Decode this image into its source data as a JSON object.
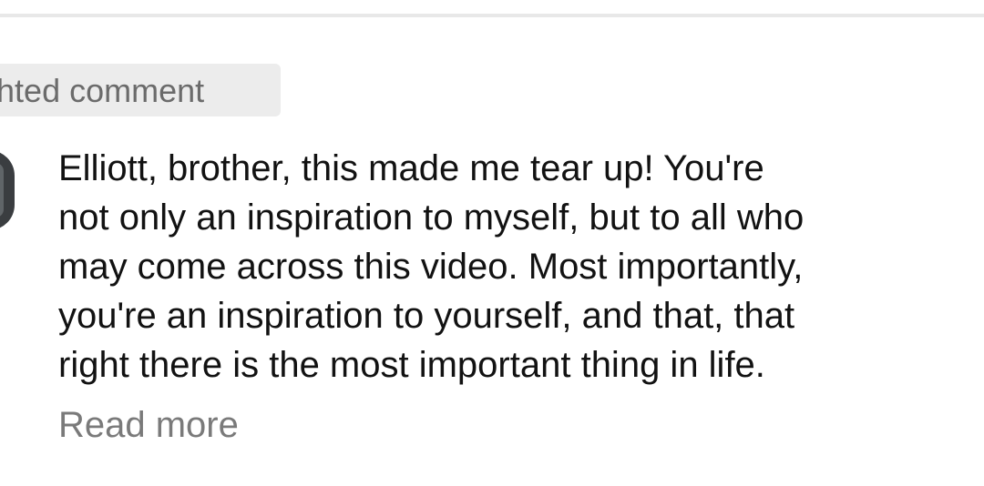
{
  "badge": {
    "label": "ighted comment"
  },
  "comment": {
    "lines": [
      "Elliott, brother, this made me tear up! You're",
      "not only an inspiration to myself, but to all who",
      "may come across this video. Most importantly,",
      "you're an inspiration to yourself, and that, that",
      "right there is the most important thing in life."
    ],
    "read_more_label": "Read more"
  },
  "colors": {
    "badge_background": "#ececec",
    "comment_text": "#121212",
    "secondary_text": "#7a7a7a"
  }
}
